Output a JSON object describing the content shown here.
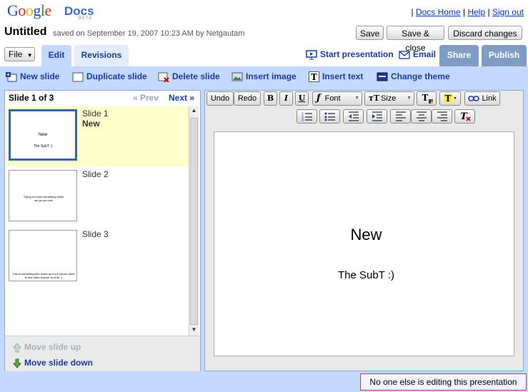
{
  "app": {
    "logo_google": "Google",
    "logo_docs": "Docs",
    "logo_beta": "BETA"
  },
  "toplinks": {
    "separator": "|",
    "docs_home": "Docs Home",
    "help": "Help",
    "sign_out": "Sign out"
  },
  "document": {
    "title": "Untitled",
    "saved_info": "saved on September 19, 2007 10:23 AM by Netgautam"
  },
  "buttons": {
    "save": "Save",
    "save_close": "Save & close",
    "discard": "Discard changes"
  },
  "tabs": {
    "file": "File",
    "edit": "Edit",
    "revisions": "Revisions",
    "start_presentation": "Start presentation",
    "email": "Email",
    "share": "Share",
    "publish": "Publish"
  },
  "actions": {
    "new_slide": "New slide",
    "duplicate_slide": "Duplicate slide",
    "delete_slide": "Delete slide",
    "insert_image": "Insert image",
    "insert_text": "Insert text",
    "change_theme": "Change theme"
  },
  "slide_panel": {
    "count": "Slide 1 of 3",
    "prev": "« Prev",
    "next": "Next »",
    "slides": [
      {
        "label": "Slide 1",
        "name": "New",
        "thumb_title": "New",
        "thumb_sub": "The SubT :)"
      },
      {
        "label": "Slide 2",
        "name": "",
        "thumb_text": "Trying to move something when we go out now"
      },
      {
        "label": "Slide 3",
        "name": "",
        "thumb_text": "This is something like footer and it is shown there is real other feature for this! :)"
      }
    ],
    "move_up": "Move slide up",
    "move_down": "Move slide down"
  },
  "editor_toolbar": {
    "undo": "Undo",
    "redo": "Redo",
    "bold": "B",
    "italic": "I",
    "underline": "U",
    "font": "Font",
    "size": "Size",
    "link": "Link"
  },
  "slide": {
    "title": "New",
    "subtitle": "The SubT :)"
  },
  "status": {
    "text": "No one else is editing this presentation"
  },
  "colors": {
    "accent": "#1a3aa8",
    "band": "#c3d9ff",
    "share_tab": "#7e9cc4",
    "selected_slide": "#ffffcc",
    "status_border": "#cc3366"
  }
}
